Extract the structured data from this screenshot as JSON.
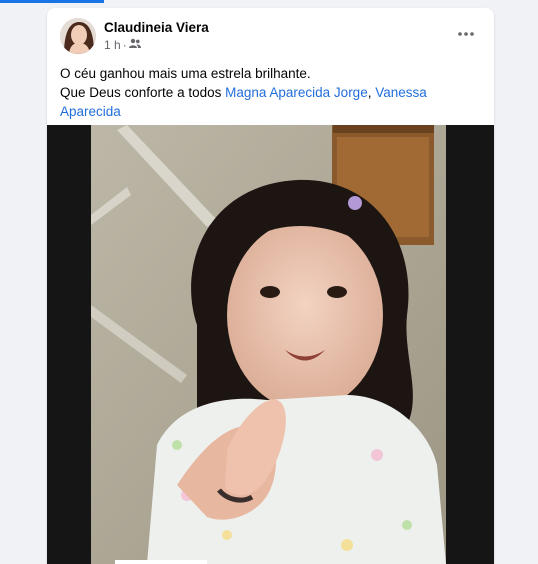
{
  "post": {
    "author": "Claudineia Viera",
    "time": "1 h",
    "separator": "·",
    "audience_icon": "friends-icon",
    "more_icon": "more-options-icon",
    "text_line1": "O céu ganhou mais uma estrela brilhante.",
    "text_line2_prefix": "Que Deus conforte a todos ",
    "tag1": "Magna Aparecida Jorge",
    "tag_separator": ", ",
    "tag2": "Vanessa Aparecida"
  },
  "colors": {
    "tag": "#216fdb",
    "muted": "#65676b",
    "accent": "#1b74e4"
  }
}
